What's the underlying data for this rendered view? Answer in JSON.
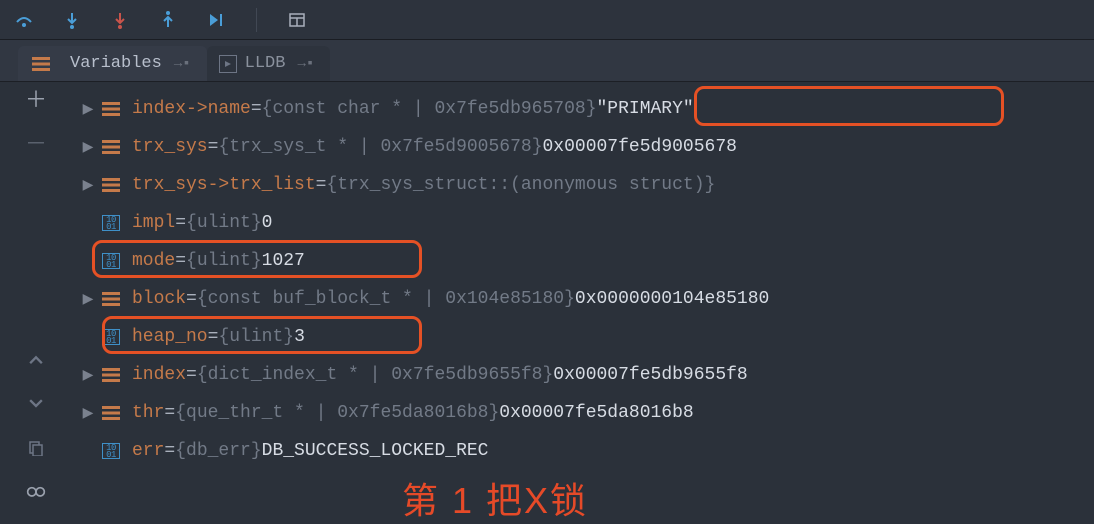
{
  "toolbar": {
    "icons": [
      "step-over",
      "step-into",
      "force-step-into",
      "step-out",
      "run-to-cursor",
      "evaluate"
    ]
  },
  "tabs": {
    "variables_label": "Variables",
    "lldb_label": "LLDB"
  },
  "vars": [
    {
      "kind": "struct",
      "expand": true,
      "name": "index->name",
      "type": "{const char * | 0x7fe5db965708}",
      "value": "\"PRIMARY\""
    },
    {
      "kind": "struct",
      "expand": true,
      "name": "trx_sys",
      "type": "{trx_sys_t * | 0x7fe5d9005678}",
      "value": "0x00007fe5d9005678"
    },
    {
      "kind": "struct",
      "expand": true,
      "name": "trx_sys->trx_list",
      "type": "{trx_sys_struct::(anonymous struct)}",
      "value": ""
    },
    {
      "kind": "prim",
      "expand": false,
      "name": "impl",
      "type": "{ulint}",
      "value": "0"
    },
    {
      "kind": "prim",
      "expand": false,
      "name": "mode",
      "type": "{ulint}",
      "value": "1027"
    },
    {
      "kind": "struct",
      "expand": true,
      "name": "block",
      "type": "{const buf_block_t * | 0x104e85180}",
      "value": "0x0000000104e85180"
    },
    {
      "kind": "prim",
      "expand": false,
      "name": "heap_no",
      "type": "{ulint}",
      "value": "3"
    },
    {
      "kind": "struct",
      "expand": true,
      "name": "index",
      "type": "{dict_index_t * | 0x7fe5db9655f8}",
      "value": "0x00007fe5db9655f8"
    },
    {
      "kind": "struct",
      "expand": true,
      "name": "thr",
      "type": "{que_thr_t * | 0x7fe5da8016b8}",
      "value": "0x00007fe5da8016b8"
    },
    {
      "kind": "prim",
      "expand": false,
      "name": "err",
      "type": "{db_err}",
      "value": "DB_SUCCESS_LOCKED_REC"
    }
  ],
  "annotations": {
    "caption": "第 1 把X锁"
  }
}
